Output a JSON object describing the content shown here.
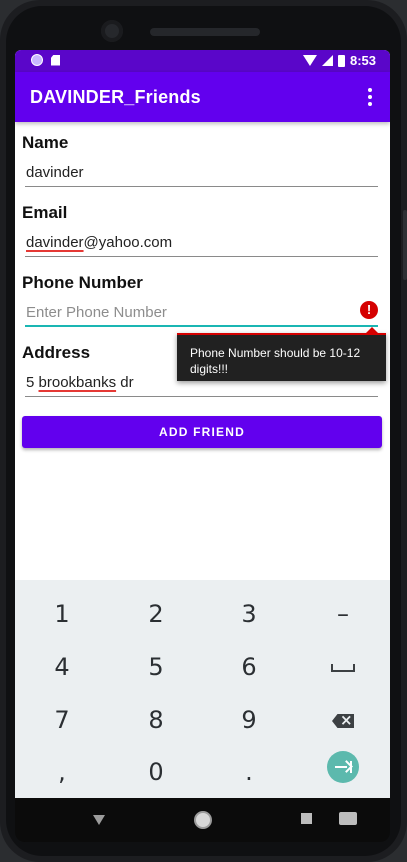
{
  "status_bar": {
    "time": "8:53",
    "icons": [
      "notification-dot-icon",
      "sd-card-icon",
      "wifi-icon",
      "signal-icon",
      "battery-icon"
    ]
  },
  "app_bar": {
    "title": "DAVINDER_Friends",
    "menu_icon": "overflow-menu-icon",
    "color": "#6200ee"
  },
  "form": {
    "name": {
      "label": "Name",
      "value": "davinder"
    },
    "email": {
      "label": "Email",
      "value_start": "davinder",
      "value_rest": "@yahoo.com"
    },
    "phone": {
      "label": "Phone Number",
      "placeholder": "Enter Phone Number",
      "error": "Phone Number should be 10-12 digits!!!",
      "error_icon": "!"
    },
    "address": {
      "label": "Address",
      "value_prefix": "5 ",
      "value_misspelled": "brookbanks",
      "value_suffix": " dr"
    },
    "submit_label": "ADD FRIEND"
  },
  "keyboard": {
    "rows": [
      [
        "1",
        "2",
        "3",
        "–"
      ],
      [
        "4",
        "5",
        "6",
        "space"
      ],
      [
        "7",
        "8",
        "9",
        "backspace"
      ],
      [
        ",",
        "0",
        ".",
        "enter"
      ]
    ],
    "accent": "#5cb9ad"
  },
  "nav_bar": {
    "icons": [
      "back-icon",
      "home-icon",
      "recents-icon",
      "keyboard-switch-icon"
    ]
  }
}
